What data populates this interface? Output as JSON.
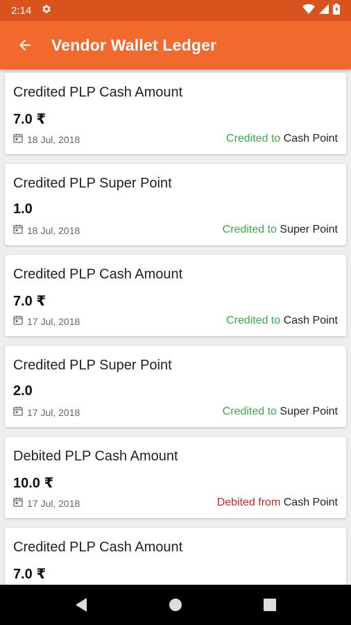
{
  "status_bar": {
    "time": "2:14"
  },
  "header": {
    "title": "Vendor Wallet Ledger"
  },
  "entries": [
    {
      "title": "Credited PLP Cash Amount",
      "amount": "7.0 ₹",
      "date": "18 Jul, 2018",
      "direction": "Credited to",
      "target": "Cash Point"
    },
    {
      "title": "Credited PLP Super Point",
      "amount": "1.0",
      "date": "18 Jul, 2018",
      "direction": "Credited to",
      "target": "Super Point"
    },
    {
      "title": "Credited PLP Cash Amount",
      "amount": "7.0 ₹",
      "date": "17 Jul, 2018",
      "direction": "Credited to",
      "target": "Cash Point"
    },
    {
      "title": "Credited PLP Super Point",
      "amount": "2.0",
      "date": "17 Jul, 2018",
      "direction": "Credited to",
      "target": "Super Point"
    },
    {
      "title": "Debited PLP Cash Amount",
      "amount": "10.0 ₹",
      "date": "17 Jul, 2018",
      "direction": "Debited from",
      "target": "Cash Point"
    },
    {
      "title": "Credited PLP Cash Amount",
      "amount": "7.0 ₹",
      "date": "",
      "direction": "",
      "target": ""
    }
  ],
  "colors": {
    "app_bar": "#f2692e",
    "status_bar": "#d9531e",
    "credit": "#3aa84a",
    "debit": "#c62828"
  }
}
